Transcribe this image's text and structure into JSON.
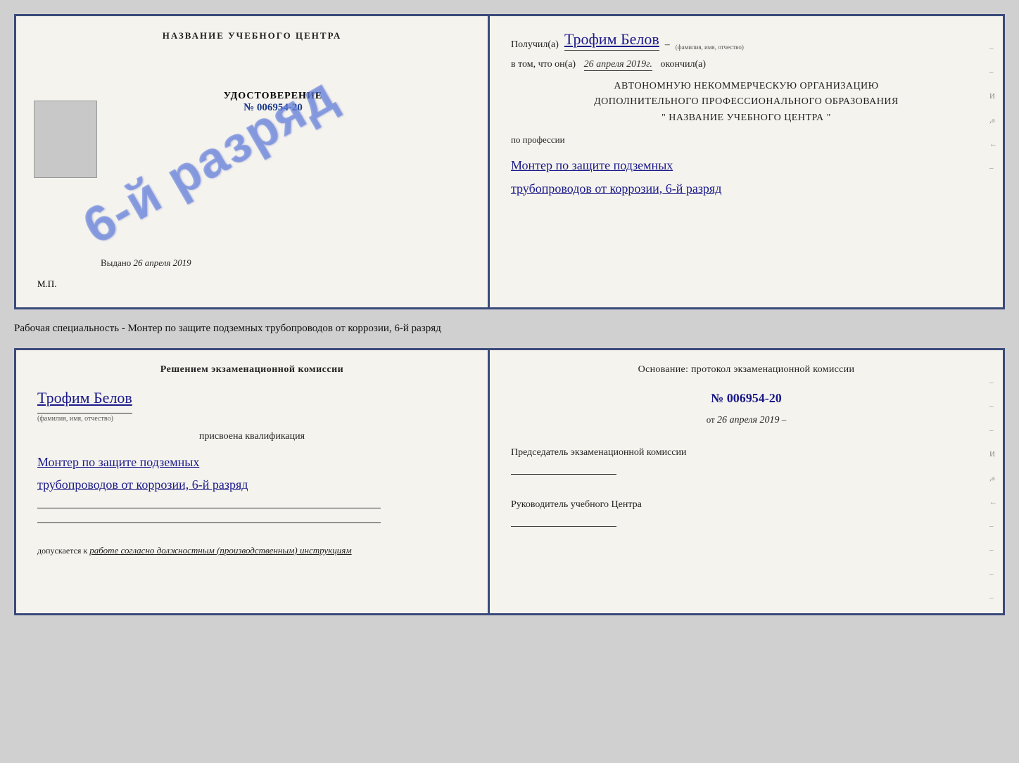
{
  "top_cert": {
    "left": {
      "training_center_title": "НАЗВАНИЕ УЧЕБНОГО ЦЕНТРА",
      "cert_label": "УДОСТОВЕРЕНИЕ",
      "cert_number": "№ 006954-20",
      "stamp_text": "6-й разряд",
      "issued_label": "Выдано",
      "issued_date": "26 апреля 2019",
      "mp_label": "М.П."
    },
    "right": {
      "received_prefix": "Получил(а)",
      "recipient_name": "Трофим Белов",
      "recipient_sublabel": "(фамилия, имя, отчество)",
      "dash": "–",
      "date_prefix": "в том, что он(а)",
      "date_value": "26 апреля 2019г.",
      "finished_label": "окончил(а)",
      "org_line1": "АВТОНОМНУЮ НЕКОММЕРЧЕСКУЮ ОРГАНИЗАЦИЮ",
      "org_line2": "ДОПОЛНИТЕЛЬНОГО ПРОФЕССИОНАЛЬНОГО ОБРАЗОВАНИЯ",
      "org_line3": "\"     НАЗВАНИЕ УЧЕБНОГО ЦЕНТРА     \"",
      "profession_label": "по профессии",
      "profession_line1": "Монтер по защите подземных",
      "profession_line2": "трубопроводов от коррозии, 6-й разряд"
    }
  },
  "middle": {
    "text": "Рабочая специальность - Монтер по защите подземных трубопроводов от коррозии, 6-й разряд"
  },
  "bottom_cert": {
    "left": {
      "decision_text": "Решением экзаменационной комиссии",
      "person_name": "Трофим Белов",
      "person_sublabel": "(фамилия, имя, отчество)",
      "qualification_prefix": "присвоена квалификация",
      "qualification_line1": "Монтер по защите подземных",
      "qualification_line2": "трубопроводов от коррозии, 6-й разряд",
      "admission_prefix": "допускается к",
      "admission_text": "работе согласно должностным (производственным) инструкциям"
    },
    "right": {
      "basis_text": "Основание: протокол экзаменационной комиссии",
      "protocol_number": "№ 006954-20",
      "from_label": "от",
      "from_date": "26 апреля 2019",
      "chairman_title": "Председатель экзаменационной комиссии",
      "director_title": "Руководитель учебного Центра"
    },
    "margin_marks": [
      "-",
      "-",
      "-",
      "И",
      "а",
      "←",
      "-",
      "-",
      "-",
      "-"
    ]
  }
}
